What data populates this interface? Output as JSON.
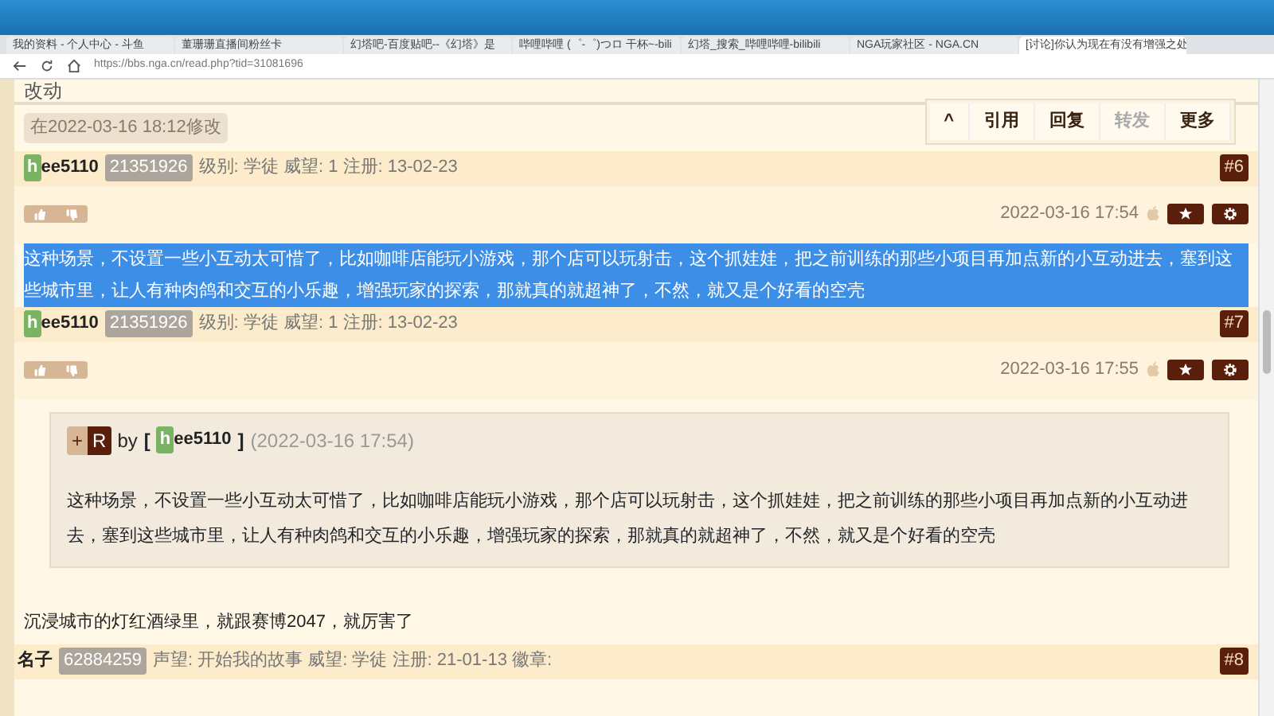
{
  "browser": {
    "tabs": [
      {
        "title": "我的资料 - 个人中心 - 斗鱼",
        "selected": false
      },
      {
        "title": "董珊珊直播间粉丝卡",
        "selected": false
      },
      {
        "title": "幻塔吧-百度贴吧--《幻塔》是",
        "selected": false
      },
      {
        "title": "哔哩哔哩 (゜-゜)つロ 干杯~-bili",
        "selected": false
      },
      {
        "title": "幻塔_搜索_哔哩哔哩-bilibili",
        "selected": false
      },
      {
        "title": "NGA玩家社区 - NGA.CN",
        "selected": false
      },
      {
        "title": "[讨论]你认为现在有没有增强之处",
        "selected": true
      }
    ],
    "address": "https://bbs.nga.cn/read.php?tid=31081696"
  },
  "previous_post": {
    "text": "改动",
    "edit_note": "在2022-03-16 18:12修改"
  },
  "action_bar": {
    "buttons": [
      {
        "label": "^",
        "disabled": false
      },
      {
        "label": "引用",
        "disabled": false
      },
      {
        "label": "回复",
        "disabled": false
      },
      {
        "label": "转发",
        "disabled": true
      },
      {
        "label": "更多",
        "disabled": false
      }
    ]
  },
  "posts": [
    {
      "user_initial": "h",
      "user_rest": "ee5110",
      "uid": "21351926",
      "meta": "级别: 学徒 威望: 1 注册: 13-02-23",
      "floor": "#6",
      "time": "2022-03-16 17:54",
      "content": "这种场景，不设置一些小互动太可惜了，比如咖啡店能玩小游戏，那个店可以玩射击，这个抓娃娃，把之前训练的那些小项目再加点新的小互动进去，塞到这些城市里，让人有种肉鸽和交互的小乐趣，增强玩家的探索，那就真的就超神了，不然，就又是个好看的空壳",
      "selected": true
    },
    {
      "user_initial": "h",
      "user_rest": "ee5110",
      "uid": "21351926",
      "meta": "级别: 学徒 威望: 1 注册: 13-02-23",
      "floor": "#7",
      "time": "2022-03-16 17:55",
      "quote": {
        "plus": "+",
        "badge": "R",
        "by": "by",
        "open": "[",
        "user_initial": "h",
        "user_rest": "ee5110",
        "close": "]",
        "time": "(2022-03-16 17:54)",
        "text": "这种场景，不设置一些小互动太可惜了，比如咖啡店能玩小游戏，那个店可以玩射击，这个抓娃娃，把之前训练的那些小项目再加点新的小互动进去，塞到这些城市里，让人有种肉鸽和交互的小乐趣，增强玩家的探索，那就真的就超神了，不然，就又是个好看的空壳"
      },
      "content": "沉浸城市的灯红酒绿里，就跟赛博2047，就厉害了",
      "selected": false
    },
    {
      "user_rest": "名子",
      "uid": "62884259",
      "meta": "声望: 开始我的故事 威望: 学徒 注册: 21-01-13 徽章:",
      "floor": "#8"
    }
  ]
}
